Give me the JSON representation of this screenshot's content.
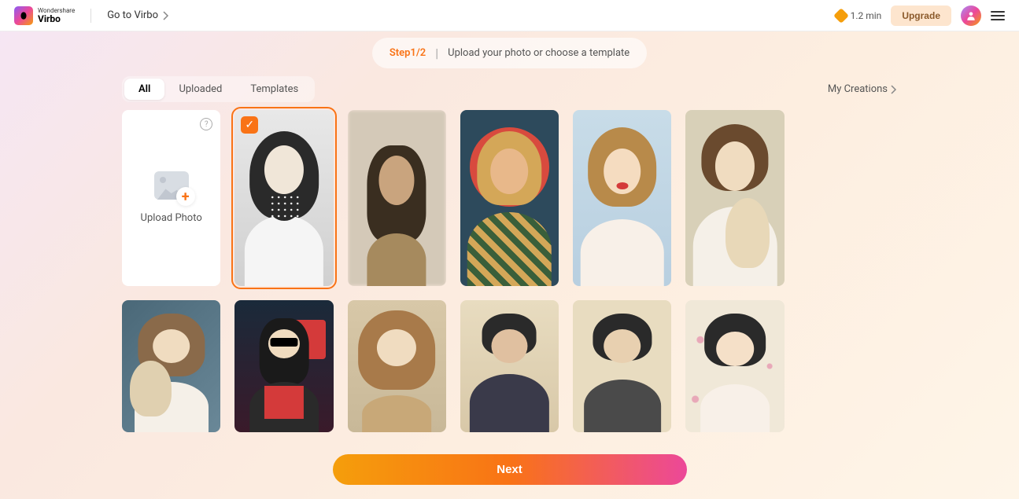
{
  "brand": {
    "top": "Wondershare",
    "bottom": "Virbo"
  },
  "nav": {
    "goto_label": "Go to Virbo"
  },
  "credits": {
    "value": "1.2 min"
  },
  "upgrade": {
    "label": "Upgrade"
  },
  "step": {
    "label": "Step1/2",
    "instruction": "Upload your photo or choose a template"
  },
  "tabs": {
    "all": "All",
    "uploaded": "Uploaded",
    "templates": "Templates"
  },
  "my_creations": {
    "label": "My Creations"
  },
  "upload_card": {
    "label": "Upload Photo"
  },
  "next": {
    "label": "Next"
  },
  "templates_row1": [
    {
      "id": "t1",
      "selected": true,
      "desc": "Black and white vintage woman with polka-dot scarf"
    },
    {
      "id": "t2",
      "selected": false,
      "desc": "Woman looking up with trees behind, blurred"
    },
    {
      "id": "t3",
      "selected": false,
      "desc": "Illustrated man with curly blond hair, plaid shirt, red circle background"
    },
    {
      "id": "t4",
      "selected": false,
      "desc": "Vintage blonde woman, red lips, off-shoulder top, sky blue background"
    },
    {
      "id": "t5",
      "selected": false,
      "desc": "Young person holding a rabbit, soft warm tones"
    }
  ],
  "templates_row2": [
    {
      "id": "t6",
      "desc": "Young woman holding bunny plush, cool background"
    },
    {
      "id": "t7",
      "desc": "Woman with sunglasses, black jacket, red top, city neon background"
    },
    {
      "id": "t8",
      "desc": "Woman with wavy golden-brown hair, warm sepia tones"
    },
    {
      "id": "t9",
      "desc": "Watercolor style man in suit, beige paper background"
    },
    {
      "id": "t10",
      "desc": "Sketched man portrait, dark hair, sepia background"
    },
    {
      "id": "t11",
      "desc": "Woman with cherry blossoms, East Asian style portrait"
    }
  ]
}
